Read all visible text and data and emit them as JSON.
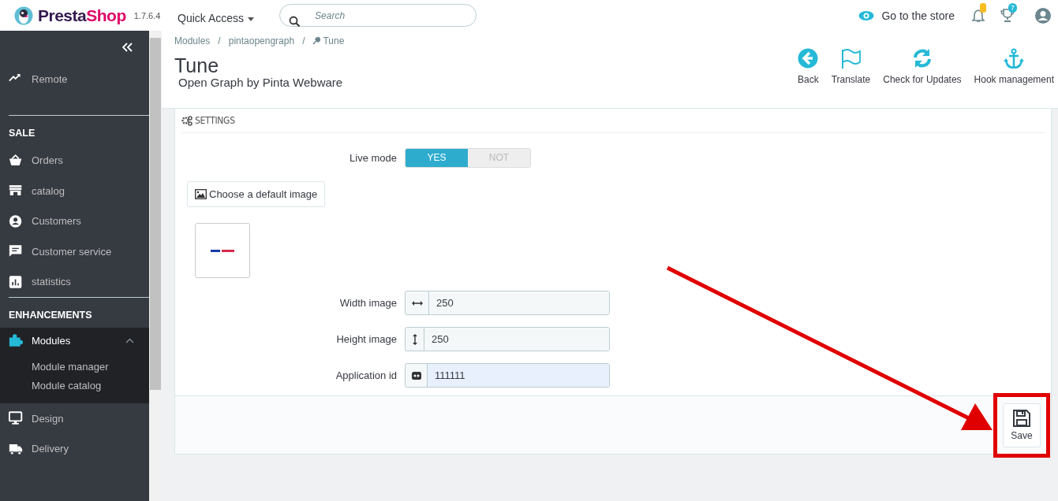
{
  "header": {
    "logo": "PrestaShop",
    "version": "1.7.6.4",
    "quick_access": "Quick Access",
    "search": {
      "placeholder": "Search"
    },
    "store_link": "Go to the store",
    "customers_badge": "7"
  },
  "sidebar": {
    "items": [
      {
        "kind": "link",
        "label": "Remote",
        "selected": false
      },
      {
        "kind": "section",
        "label": "SALE"
      },
      {
        "kind": "link",
        "label": "Orders",
        "selected": false
      },
      {
        "kind": "link",
        "label": "catalog",
        "selected": false
      },
      {
        "kind": "link",
        "label": "Customers",
        "selected": false
      },
      {
        "kind": "link",
        "label": "Customer service",
        "selected": false
      },
      {
        "kind": "link",
        "label": "statistics",
        "selected": false
      },
      {
        "kind": "section",
        "label": "ENHANCEMENTS"
      },
      {
        "kind": "link",
        "label": "Modules",
        "selected": true,
        "expanded": true,
        "children": [
          {
            "label": "Module manager"
          },
          {
            "label": "Module catalog"
          }
        ]
      },
      {
        "kind": "link",
        "label": "Design",
        "selected": false
      },
      {
        "kind": "link",
        "label": "Delivery",
        "selected": false
      }
    ]
  },
  "breadcrumb": {
    "separator": "/",
    "items": [
      "Modules",
      "pintaopengraph",
      "Tune"
    ]
  },
  "page_title": "Tune",
  "page_subtitle": "Open Graph by Pinta Webware",
  "toolbar": [
    {
      "kind": "back",
      "label": "Back"
    },
    {
      "kind": "flag",
      "label": "Translate"
    },
    {
      "kind": "refresh",
      "label": "Check for Updates"
    },
    {
      "kind": "anchor",
      "label": "Hook management"
    }
  ],
  "panel": {
    "heading": "SETTINGS",
    "switch": {
      "label": "Live mode",
      "options": [
        {
          "label": "YES",
          "selected": true
        },
        {
          "label": "NOT",
          "selected": false
        }
      ]
    },
    "image_button": "Choose a default image",
    "fields": [
      {
        "kind": "width",
        "label": "Width image",
        "value": "250",
        "highlighted": false
      },
      {
        "kind": "height",
        "label": "Height image",
        "value": "250",
        "highlighted": false
      },
      {
        "kind": "id",
        "label": "Application id",
        "value": "111111",
        "highlighted": true
      }
    ],
    "save_button": "Save"
  }
}
